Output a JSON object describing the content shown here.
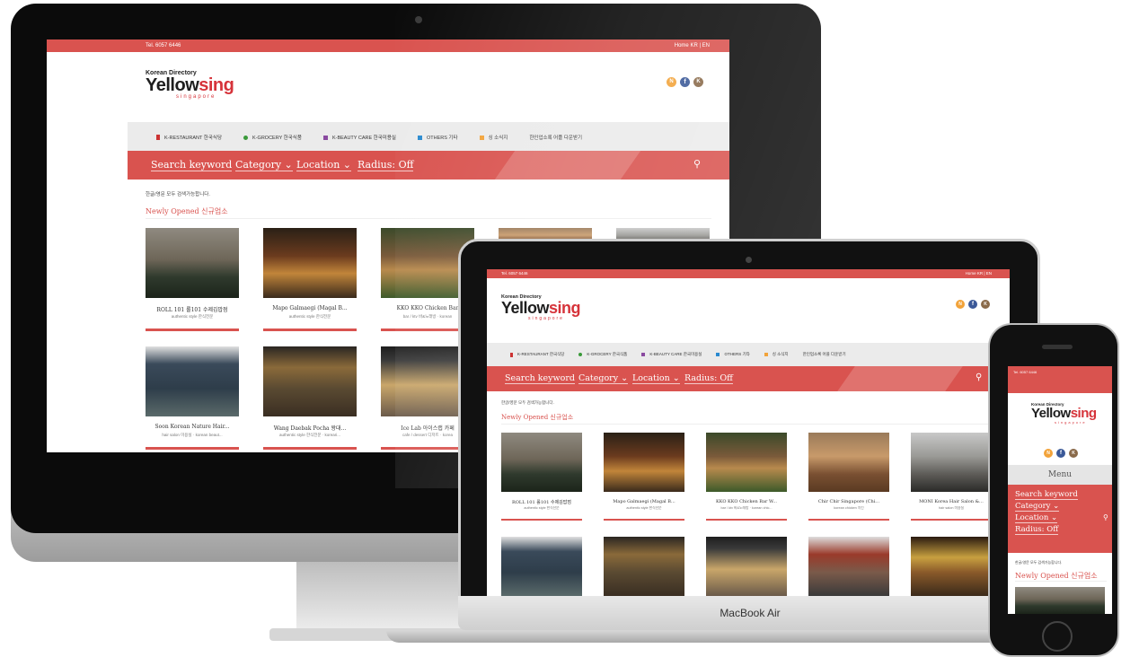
{
  "site": {
    "topbar_left": "Tel. 6057 6446",
    "topbar_right": "Home    KR | EN",
    "logo_small": "Korean Directory",
    "logo_main_black": "Yellow",
    "logo_main_red": "sing",
    "logo_sub": "singapore",
    "nav_items": [
      {
        "label": "K-RESTAURANT 한국식당"
      },
      {
        "label": "K-GROCERY 한국식품"
      },
      {
        "label": "K-BEAUTY CARE 한국미용실"
      },
      {
        "label": "OTHERS 기타"
      },
      {
        "label": "싱 소식지"
      },
      {
        "label": "한인업소록 어플 다운받기"
      }
    ],
    "search": {
      "keyword": "Search keyword",
      "category": "Category",
      "location": "Location",
      "radius": "Radius: Off"
    },
    "note": "한글/영문 모두 검색가능합니다.",
    "section_title": "Newly Opened 신규업소",
    "menu_label": "Menu",
    "listings": [
      {
        "name": "ROLL 101 롤101 수제김밥점",
        "tags": "authentic style 한식전문"
      },
      {
        "name": "Mapo Galmaegi (Magal B...",
        "tags": "authentic style 한식전문"
      },
      {
        "name": "KKO KKO Chicken Bar W...",
        "tags": "bar / ktv 바&노래방 · korean chic..."
      },
      {
        "name": "Chir Chir Singapore (Chi...",
        "tags": "korean chicken 치킨"
      },
      {
        "name": "MONI Korea Hair Salon &...",
        "tags": "hair salon 미용실"
      },
      {
        "name": "Soon Korean Nature Hair...",
        "tags": "hair salon 미용실 · korean beaut..."
      },
      {
        "name": "Wang Daebak Pocha 왕대...",
        "tags": "authentic style 한식전문 · koreari..."
      },
      {
        "name": "Ice Lab 아이스랩 카페",
        "tags": "cafe / dessert 디저트 · korea..."
      }
    ],
    "imac_card_names": [
      "ROLL 101 롤101 수제김밥점",
      "Mapo Galmaegi (Magal B...",
      "KKO KKO Chicken Bar",
      "Soon Korean Nature Hair...",
      "Wang Daebak Pocha 왕대...",
      "Ice Lab 아이스랩 카페"
    ],
    "imac_card_tags": [
      "authentic style 한식전문",
      "authentic style 한식전문",
      "bar / ktv 바&노래방 · korean",
      "hair salon 미용실 · korean beaut...",
      "authentic style 한식전문 · koreari...",
      "cafe / dessert 디저트 · korea"
    ]
  },
  "devices": {
    "macbook_label": "MacBook Air",
    "apple_logo": "apple-icon"
  },
  "colors": {
    "accent": "#d9534f",
    "logo_red": "#d6333a",
    "nav_bg": "#ebebeb"
  }
}
